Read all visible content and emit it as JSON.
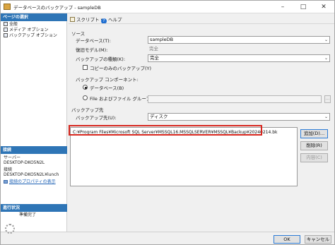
{
  "window": {
    "title": "データベースのバックアップ - sampleDB"
  },
  "left_pane": {
    "select_page_header": "ページの選択",
    "pages": [
      "全般",
      "メディア オプション",
      "バックアップ オプション"
    ],
    "connection_header": "接続",
    "server_label": "サーバー",
    "server_value": "DESKTOP-DKO5N2L",
    "connection_label": "接続",
    "connection_value": "DESKTOP-DKO5N2L¥lunch",
    "connection_properties_link": "接続のプロパティの表示",
    "progress_header": "進行状況",
    "progress_status": "準備完了"
  },
  "toolbar": {
    "script_label": "スクリプト",
    "help_label": "ヘルプ"
  },
  "source": {
    "section_label": "ソース",
    "database_label": "データベース(T):",
    "database_value": "sampleDB",
    "recovery_model_label": "復旧モデル(M):",
    "recovery_model_value": "完全",
    "backup_type_label": "バックアップの種類(K):",
    "backup_type_value": "完全",
    "copy_only_label": "コピーのみのバックアップ(Y)",
    "copy_only_checked": false,
    "component_label": "バックアップ コンポーネント:",
    "component_database_label": "データベース(B)",
    "component_files_label": "File およびファイル グループ(G):",
    "component_selected": "database",
    "browse_label": "..."
  },
  "destination": {
    "section_label": "バックアップ先",
    "backup_to_label": "バックアップ先(U):",
    "backup_to_value": "ディスク",
    "paths": [
      "C:¥Program Files¥Microsoft SQL Server¥MSSQL16.MSSQLSERVER¥MSSQL¥Backup¥20240214.bk"
    ],
    "add_button": "追加(D)...",
    "remove_button": "削除(R)",
    "contents_button": "内容(C)"
  },
  "footer": {
    "ok_label": "OK",
    "cancel_label": "キャンセル"
  },
  "colors": {
    "accent": "#2e75b6",
    "highlight": "#d7261e",
    "link": "#1a5fb4"
  }
}
